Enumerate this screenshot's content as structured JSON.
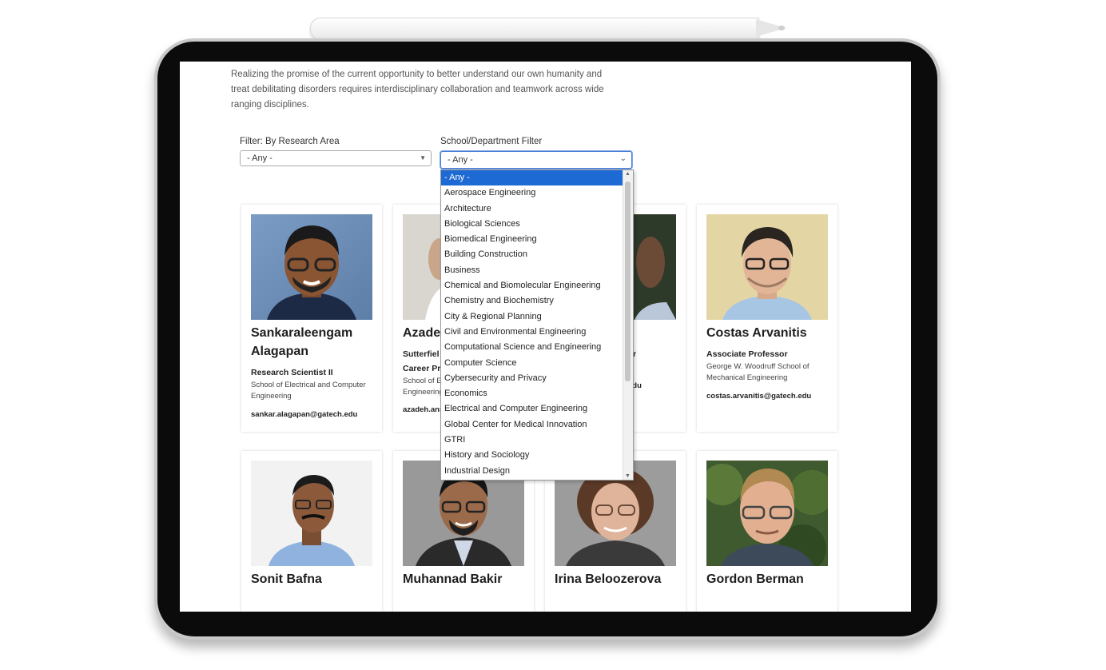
{
  "intro": "Realizing the promise of the current opportunity to better understand our own humanity and treat debilitating disorders requires interdisciplinary collaboration and teamwork across wide ranging disciplines.",
  "filters": {
    "research_label": "Filter: By Research Area",
    "research_value": "- Any -",
    "school_label": "School/Department Filter",
    "school_value": "- Any -",
    "options": [
      "- Any -",
      "Aerospace Engineering",
      "Architecture",
      "Biological Sciences",
      "Biomedical Engineering",
      "Building Construction",
      "Business",
      "Chemical and Biomolecular Engineering",
      "Chemistry and Biochemistry",
      "City & Regional Planning",
      "Civil and Environmental Engineering",
      "Computational Science and Engineering",
      "Computer Science",
      "Cybersecurity and Privacy",
      "Economics",
      "Electrical and Computer Engineering",
      "Global Center for Medical Innovation",
      "GTRI",
      "History and Sociology",
      "Industrial Design"
    ]
  },
  "people": [
    {
      "name_line1": "Sankaraleengam",
      "name_line2": "Alagapan",
      "title": "Research Scientist II",
      "school_line1": "School of Electrical and Computer",
      "school_line2": "Engineering",
      "email": "sankar.alagapan@gatech.edu"
    },
    {
      "name_line1": "Azadeh",
      "title_line1": "Sutterfiel",
      "title_line2": "Career Pr",
      "school_line1": "School of E",
      "school_line2": "Engineering",
      "email": "azadeh.ans"
    },
    {
      "title_fragment": "r",
      "email_fragment": "edu"
    },
    {
      "name_line1": "Costas Arvanitis",
      "title": "Associate Professor",
      "school_line1": "George W. Woodruff School of",
      "school_line2": "Mechanical Engineering",
      "email": "costas.arvanitis@gatech.edu"
    },
    {
      "name_line1": "Sonit Bafna"
    },
    {
      "name_line1": "Muhannad Bakir"
    },
    {
      "name_line1": "Irina Beloozerova"
    },
    {
      "name_line1": "Gordon Berman"
    }
  ]
}
